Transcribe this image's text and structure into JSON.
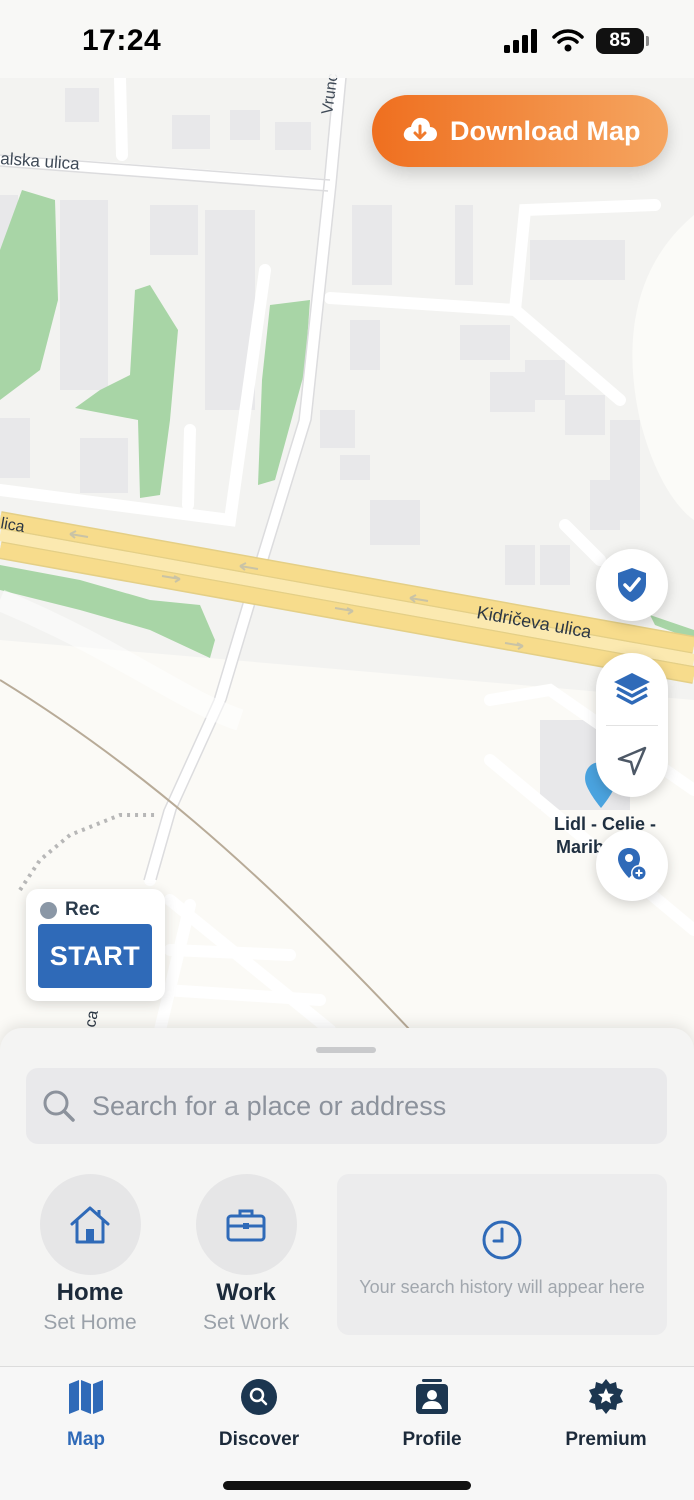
{
  "status_bar": {
    "time": "17:24",
    "battery": "85"
  },
  "map": {
    "streets": [
      "alska ulica",
      "Vrunc",
      "Kidričeva ulica",
      "lica",
      "ca"
    ],
    "poi": {
      "name_line1": "Lidl - Celie -",
      "name_line2": "Marib"
    }
  },
  "download_button": {
    "label": "Download Map",
    "icon": "cloud-download-icon"
  },
  "map_controls": {
    "shield_icon": "shield-check-icon",
    "layers_icon": "layers-icon",
    "locate_icon": "navigation-arrow-icon",
    "add_place_icon": "add-place-icon"
  },
  "recording": {
    "label": "Rec",
    "start_label": "START"
  },
  "search": {
    "placeholder": "Search for a place or address"
  },
  "quick_places": [
    {
      "title": "Home",
      "subtitle": "Set Home",
      "icon": "house-icon"
    },
    {
      "title": "Work",
      "subtitle": "Set Work",
      "icon": "briefcase-icon"
    }
  ],
  "history": {
    "text": "Your search history will appear here",
    "icon": "clock-icon"
  },
  "tabs": [
    {
      "label": "Map",
      "icon": "map-icon",
      "active": true
    },
    {
      "label": "Discover",
      "icon": "discover-search-icon",
      "active": false
    },
    {
      "label": "Profile",
      "icon": "profile-icon",
      "active": false
    },
    {
      "label": "Premium",
      "icon": "star-badge-icon",
      "active": false
    }
  ],
  "colors": {
    "accent": "#2f6ab8",
    "download_start": "#ef6f1f",
    "download_end": "#f5a560",
    "road_major": "#f7dc8c",
    "park": "#a8d5a6"
  }
}
